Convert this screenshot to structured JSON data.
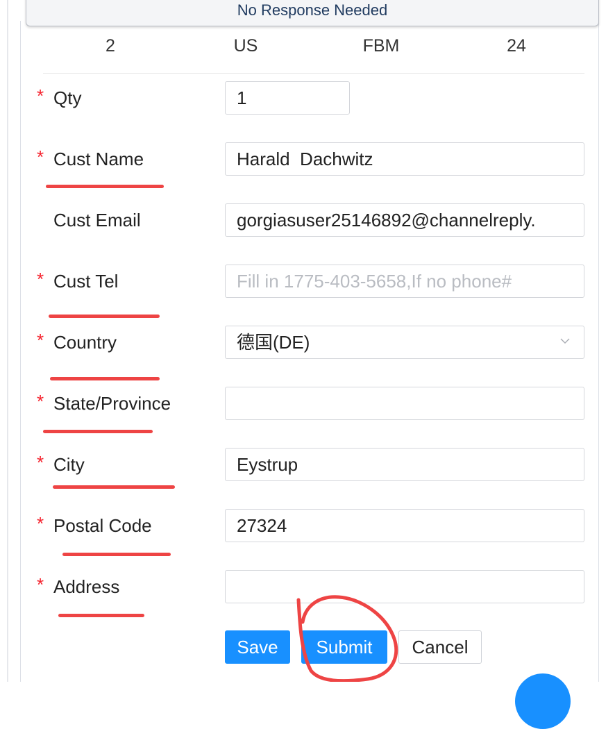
{
  "banner": {
    "label": "No Response Needed"
  },
  "summary": {
    "quantity": "2",
    "marketplace": "US",
    "fulfillment": "FBM",
    "hours": "24"
  },
  "form": {
    "qty": {
      "label": "Qty",
      "value": "1",
      "required": true
    },
    "cust_name": {
      "label": "Cust Name",
      "value": "Harald  Dachwitz",
      "required": true
    },
    "cust_email": {
      "label": "Cust Email",
      "value": "gorgiasuser25146892@channelreply.",
      "required": false
    },
    "cust_tel": {
      "label": "Cust Tel",
      "value": "",
      "placeholder": "Fill in 1775-403-5658,If no phone#",
      "required": true
    },
    "country": {
      "label": "Country",
      "value": "德国(DE)",
      "required": true
    },
    "state": {
      "label": "State/Province",
      "value": "",
      "required": true
    },
    "city": {
      "label": "City",
      "value": "Eystrup",
      "required": true
    },
    "postal_code": {
      "label": "Postal Code",
      "value": "27324",
      "required": true
    },
    "address": {
      "label": "Address",
      "value": "",
      "required": true
    },
    "required_mark": "*"
  },
  "actions": {
    "save_label": "Save",
    "submit_label": "Submit",
    "cancel_label": "Cancel"
  },
  "colors": {
    "primary": "#1890ff",
    "required": "#f5222d",
    "annotation": "#ee4444"
  }
}
